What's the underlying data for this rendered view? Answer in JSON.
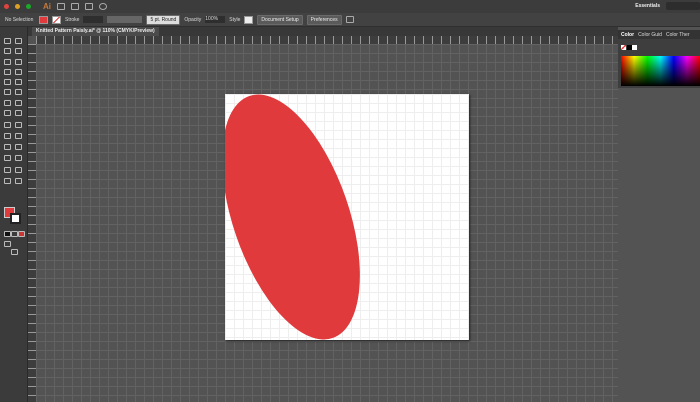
{
  "app": {
    "logo": "Ai",
    "workspace": "Essentials",
    "accent": "#c77a3a"
  },
  "control": {
    "selection": "No Selection",
    "stroke_label": "Stroke",
    "brush": "5 pt. Round",
    "opacity_label": "Opacity",
    "opacity": "100%",
    "style_label": "Style",
    "document_setup": "Document Setup",
    "preferences": "Preferences"
  },
  "document": {
    "tab": "Knitted Pattern Paisly.ai* @ 110% (CMYK/Preview)"
  },
  "panel": {
    "tabs": [
      "Color",
      "Color Guid",
      "Color Ther"
    ]
  },
  "colors": {
    "fill": "#e03a3c",
    "stroke": "none",
    "shape": "#e03a3c"
  },
  "shape": {
    "type": "ellipse",
    "fill": "#e03a3c",
    "rotation_deg": -20
  }
}
